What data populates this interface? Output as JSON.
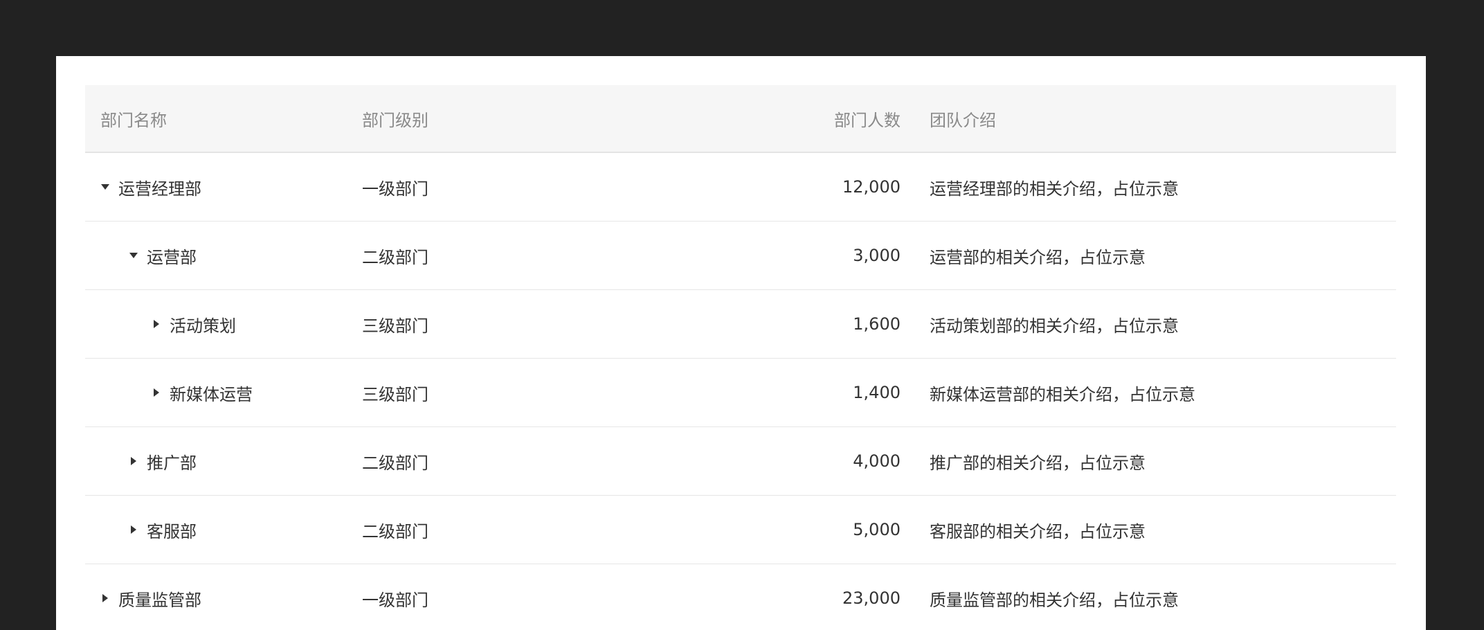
{
  "table": {
    "headers": {
      "name": "部门名称",
      "level": "部门级别",
      "count": "部门人数",
      "intro": "团队介绍"
    },
    "rows": [
      {
        "name": "运营经理部",
        "level": "一级部门",
        "count": "12,000",
        "intro": "运营经理部的相关介绍，占位示意",
        "depth": 0,
        "expanded": true
      },
      {
        "name": "运营部",
        "level": "二级部门",
        "count": "3,000",
        "intro": "运营部的相关介绍，占位示意",
        "depth": 1,
        "expanded": true
      },
      {
        "name": "活动策划",
        "level": "三级部门",
        "count": "1,600",
        "intro": "活动策划部的相关介绍，占位示意",
        "depth": 2,
        "expanded": false
      },
      {
        "name": "新媒体运营",
        "level": "三级部门",
        "count": "1,400",
        "intro": "新媒体运营部的相关介绍，占位示意",
        "depth": 2,
        "expanded": false
      },
      {
        "name": "推广部",
        "level": "二级部门",
        "count": "4,000",
        "intro": "推广部的相关介绍，占位示意",
        "depth": 1,
        "expanded": false
      },
      {
        "name": "客服部",
        "level": "二级部门",
        "count": "5,000",
        "intro": "客服部的相关介绍，占位示意",
        "depth": 1,
        "expanded": false
      },
      {
        "name": "质量监管部",
        "level": "一级部门",
        "count": "23,000",
        "intro": "质量监管部的相关介绍，占位示意",
        "depth": 0,
        "expanded": false
      }
    ]
  }
}
